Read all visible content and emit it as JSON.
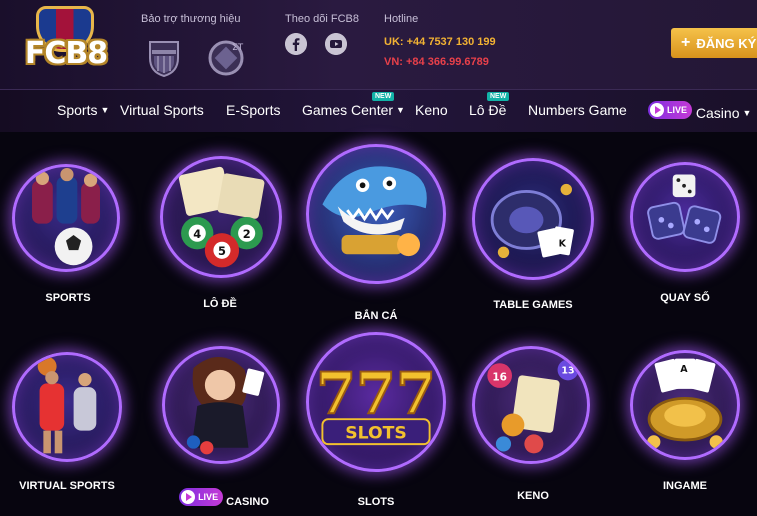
{
  "header": {
    "logo_text": "FCB8",
    "sponsor_title": "Bảo trợ thương hiệu",
    "follow_title": "Theo dõi FCB8",
    "hotline_title": "Hotline",
    "hotline_uk": "UK: +44 7537 130 199",
    "hotline_vn": "VN: +84 366.99.6789",
    "register_label": "ĐĂNG KÝ",
    "register_icon": "plus-icon"
  },
  "nav": {
    "items": [
      {
        "label": "Sports",
        "dropdown": true
      },
      {
        "label": "Virtual Sports"
      },
      {
        "label": "E-Sports"
      },
      {
        "label": "Games Center",
        "dropdown": true,
        "badge": "NEW"
      },
      {
        "label": "Keno"
      },
      {
        "label": "Lô Đề",
        "badge": "NEW"
      },
      {
        "label": "Numbers Game"
      },
      {
        "label": "Casino",
        "dropdown": true,
        "live": "LIVE"
      }
    ]
  },
  "games": {
    "row1": [
      {
        "label": "SPORTS"
      },
      {
        "label": "LÔ ĐỀ"
      },
      {
        "label": "BẮN CÁ"
      },
      {
        "label": "TABLE GAMES"
      },
      {
        "label": "QUAY SỐ"
      }
    ],
    "row2": [
      {
        "label": "VIRTUAL SPORTS"
      },
      {
        "label": "CASINO",
        "live": "LIVE"
      },
      {
        "label": "SLOTS"
      },
      {
        "label": "KENO"
      },
      {
        "label": "INGAME"
      }
    ],
    "slots_art_text": "SLOTS",
    "slots_art_number": "777",
    "lotto_numbers": [
      "4",
      "5",
      "2"
    ],
    "keno_numbers": [
      "16",
      "13"
    ]
  },
  "colors": {
    "accent_gold": "#f2b233",
    "accent_red": "#e8404a",
    "ring_purple": "#b06bff",
    "new_badge": "#12b3a8"
  }
}
